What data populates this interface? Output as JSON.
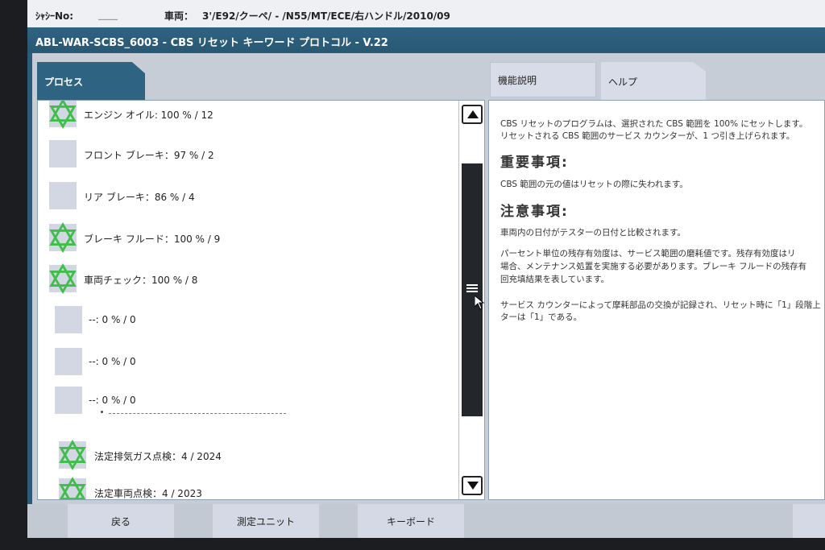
{
  "vehicle_bar": {
    "chassis_label": "ｼｬｼｰNo:",
    "chassis_value": "____",
    "vehicle_label": "車両：",
    "vehicle_value": "3'/E92/クーペ/ - /N55/MT/ECE/右ハンドル/2010/09"
  },
  "title": "ABL-WAR-SCBS_6003 - CBS リセット キーワード プロトコル - V.22",
  "tabs": {
    "process": "プロセス",
    "function": "機能説明",
    "help": "ヘルプ"
  },
  "items": [
    {
      "label": "エンジン オイル: 100 % / 12",
      "status": "ok"
    },
    {
      "label": "フロント ブレーキ：97 % / 2",
      "status": "pending"
    },
    {
      "label": "リア ブレーキ：86 % / 4",
      "status": "pending"
    },
    {
      "label": "ブレーキ フルード：100 % / 9",
      "status": "ok"
    },
    {
      "label": "車両チェック：100 % / 8",
      "status": "ok"
    },
    {
      "label": "--: 0 % / 0",
      "status": "pending"
    },
    {
      "label": "--: 0 % / 0",
      "status": "pending"
    },
    {
      "label": "--: 0 % / 0",
      "status": "pending"
    },
    {
      "label": "法定排気ガス点検：4 / 2024",
      "status": "ok"
    },
    {
      "label": "法定車両点検：4 / 2023",
      "status": "ok"
    }
  ],
  "help": {
    "para1_line1": "CBS リセットのプログラムは、選択された CBS 範囲を 100% にセットします。",
    "para1_line2": "リセットされる CBS 範囲のサービス カウンターが、1 つ引き上げられます。",
    "heading_important": "重要事項:",
    "important_text": "CBS 範囲の元の値はリセットの際に失われます。",
    "heading_caution": "注意事項:",
    "caution_text": "車両内の日付がテスターの日付と比較されます。",
    "para2_line1": "パーセント単位の残存有効度は、サービス範囲の磨耗値です。残存有効度はリ",
    "para2_line2": "場合、メンテナンス処置を実施する必要があります。ブレーキ フルードの残存有",
    "para2_line3": "回充填結果を表しています。",
    "para3_line1": "サービス カウンターによって摩耗部品の交換が記録され、リセット時に「1」段階上",
    "para3_line2": "ターは「1」である。"
  },
  "footer": {
    "back": "戻る",
    "measure_unit": "測定ユニット",
    "keyboard": "キーボード"
  },
  "colors": {
    "header_blue": "#2f6382",
    "ok_green": "#3fbf4a",
    "pending_gray": "#d3d7e3"
  }
}
